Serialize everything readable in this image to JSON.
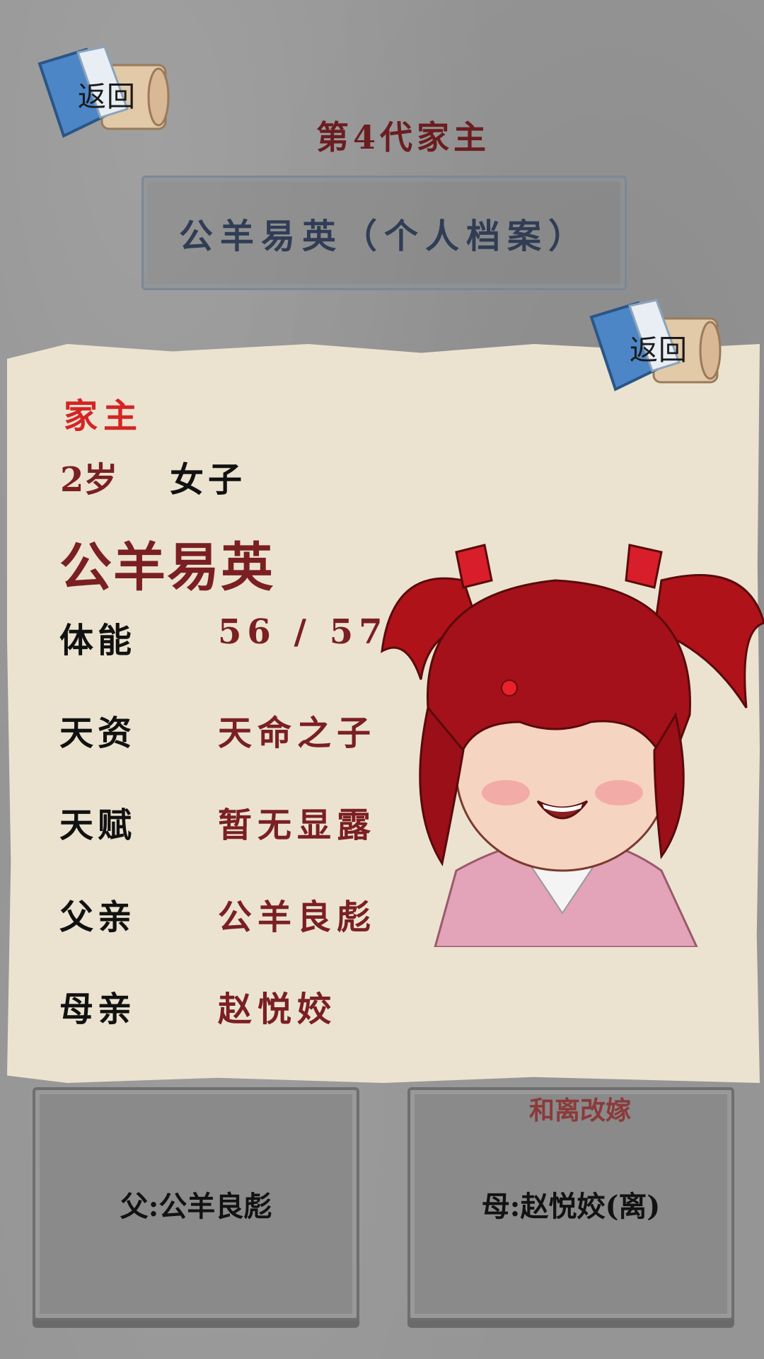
{
  "header": {
    "back_label": "返回",
    "generation_title": "第4代家主",
    "profile_title": "公羊易英（个人档案）"
  },
  "card": {
    "back_label": "返回",
    "role": "家主",
    "age": "2岁",
    "gender": "女子",
    "name": "公羊易英",
    "stats": [
      {
        "label": "体能",
        "value": "56 / 57"
      },
      {
        "label": "天资",
        "value": "天命之子"
      },
      {
        "label": "天赋",
        "value": "暂无显露"
      },
      {
        "label": "父亲",
        "value": "公羊良彪"
      },
      {
        "label": "母亲",
        "value": "赵悦姣"
      }
    ]
  },
  "family": {
    "father_label": "父:公羊良彪",
    "mother_label": "母:赵悦姣(离)",
    "divorce_label": "和离改嫁"
  },
  "colors": {
    "background": "#959595",
    "card": "#ebe3d0",
    "accent_red": "#d42424",
    "name_maroon": "#7a1f22",
    "plate_text": "#303d55"
  },
  "icons": {
    "back_button": "book-scroll-icon",
    "portrait": "character-portrait"
  }
}
